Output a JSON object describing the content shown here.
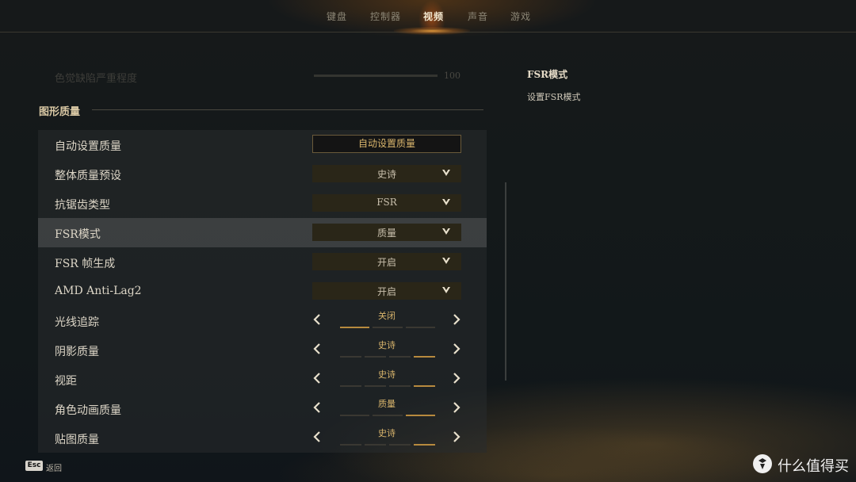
{
  "nav": {
    "tabs": [
      {
        "label": "键盘"
      },
      {
        "label": "控制器"
      },
      {
        "label": "视频"
      },
      {
        "label": "声音"
      },
      {
        "label": "游戏"
      }
    ],
    "active_index": 2
  },
  "faded_row": {
    "label": "色觉缺陷严重程度",
    "value": "100"
  },
  "section": {
    "title": "图形质量"
  },
  "settings": {
    "auto_quality": {
      "label": "自动设置质量",
      "button": "自动设置质量"
    },
    "overall_preset": {
      "label": "整体质量预设",
      "value": "史诗"
    },
    "anti_aliasing": {
      "label": "抗锯齿类型",
      "value": "FSR"
    },
    "fsr_mode": {
      "label": "FSR模式",
      "value": "质量"
    },
    "fsr_frame_gen": {
      "label": "FSR 帧生成",
      "value": "开启"
    },
    "anti_lag": {
      "label": "AMD Anti-Lag2",
      "value": "开启"
    },
    "ray_tracing": {
      "label": "光线追踪",
      "value": "关闭",
      "level_index": 0,
      "level_count": 3
    },
    "shadow_quality": {
      "label": "阴影质量",
      "value": "史诗",
      "level_index": 3,
      "level_count": 4
    },
    "view_distance": {
      "label": "视距",
      "value": "史诗",
      "level_index": 3,
      "level_count": 4
    },
    "character_anim": {
      "label": "角色动画质量",
      "value": "质量",
      "level_index": 2,
      "level_count": 3
    },
    "texture_quality": {
      "label": "贴图质量",
      "value": "史诗",
      "level_index": 3,
      "level_count": 4
    }
  },
  "info": {
    "title": "FSR模式",
    "description": "设置FSR模式"
  },
  "footer": {
    "esc_key": "Esc",
    "back_label": "返回"
  },
  "watermark": {
    "text": "什么值得买"
  },
  "colors": {
    "accent": "#b78a3e",
    "accent_text": "#d9b56c"
  }
}
